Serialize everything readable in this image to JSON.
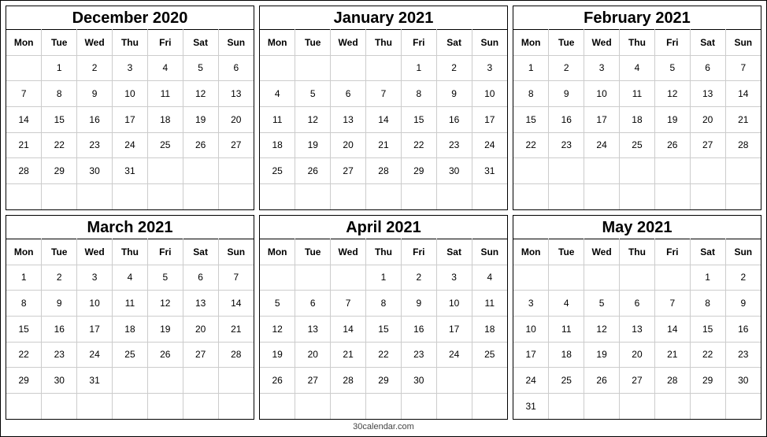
{
  "footer": "30calendar.com",
  "weekdays": [
    "Mon",
    "Tue",
    "Wed",
    "Thu",
    "Fri",
    "Sat",
    "Sun"
  ],
  "months": [
    {
      "title": "December 2020",
      "weeks": [
        [
          "",
          "1",
          "2",
          "3",
          "4",
          "5",
          "6"
        ],
        [
          "7",
          "8",
          "9",
          "10",
          "11",
          "12",
          "13"
        ],
        [
          "14",
          "15",
          "16",
          "17",
          "18",
          "19",
          "20"
        ],
        [
          "21",
          "22",
          "23",
          "24",
          "25",
          "26",
          "27"
        ],
        [
          "28",
          "29",
          "30",
          "31",
          "",
          "",
          ""
        ],
        [
          "",
          "",
          "",
          "",
          "",
          "",
          ""
        ]
      ]
    },
    {
      "title": "January 2021",
      "weeks": [
        [
          "",
          "",
          "",
          "",
          "1",
          "2",
          "3"
        ],
        [
          "4",
          "5",
          "6",
          "7",
          "8",
          "9",
          "10"
        ],
        [
          "11",
          "12",
          "13",
          "14",
          "15",
          "16",
          "17"
        ],
        [
          "18",
          "19",
          "20",
          "21",
          "22",
          "23",
          "24"
        ],
        [
          "25",
          "26",
          "27",
          "28",
          "29",
          "30",
          "31"
        ],
        [
          "",
          "",
          "",
          "",
          "",
          "",
          ""
        ]
      ]
    },
    {
      "title": "February 2021",
      "weeks": [
        [
          "1",
          "2",
          "3",
          "4",
          "5",
          "6",
          "7"
        ],
        [
          "8",
          "9",
          "10",
          "11",
          "12",
          "13",
          "14"
        ],
        [
          "15",
          "16",
          "17",
          "18",
          "19",
          "20",
          "21"
        ],
        [
          "22",
          "23",
          "24",
          "25",
          "26",
          "27",
          "28"
        ],
        [
          "",
          "",
          "",
          "",
          "",
          "",
          ""
        ],
        [
          "",
          "",
          "",
          "",
          "",
          "",
          ""
        ]
      ]
    },
    {
      "title": "March 2021",
      "weeks": [
        [
          "1",
          "2",
          "3",
          "4",
          "5",
          "6",
          "7"
        ],
        [
          "8",
          "9",
          "10",
          "11",
          "12",
          "13",
          "14"
        ],
        [
          "15",
          "16",
          "17",
          "18",
          "19",
          "20",
          "21"
        ],
        [
          "22",
          "23",
          "24",
          "25",
          "26",
          "27",
          "28"
        ],
        [
          "29",
          "30",
          "31",
          "",
          "",
          "",
          ""
        ],
        [
          "",
          "",
          "",
          "",
          "",
          "",
          ""
        ]
      ]
    },
    {
      "title": "April 2021",
      "weeks": [
        [
          "",
          "",
          "",
          "1",
          "2",
          "3",
          "4"
        ],
        [
          "5",
          "6",
          "7",
          "8",
          "9",
          "10",
          "11"
        ],
        [
          "12",
          "13",
          "14",
          "15",
          "16",
          "17",
          "18"
        ],
        [
          "19",
          "20",
          "21",
          "22",
          "23",
          "24",
          "25"
        ],
        [
          "26",
          "27",
          "28",
          "29",
          "30",
          "",
          ""
        ],
        [
          "",
          "",
          "",
          "",
          "",
          "",
          ""
        ]
      ]
    },
    {
      "title": "May 2021",
      "weeks": [
        [
          "",
          "",
          "",
          "",
          "",
          "1",
          "2"
        ],
        [
          "3",
          "4",
          "5",
          "6",
          "7",
          "8",
          "9"
        ],
        [
          "10",
          "11",
          "12",
          "13",
          "14",
          "15",
          "16"
        ],
        [
          "17",
          "18",
          "19",
          "20",
          "21",
          "22",
          "23"
        ],
        [
          "24",
          "25",
          "26",
          "27",
          "28",
          "29",
          "30"
        ],
        [
          "31",
          "",
          "",
          "",
          "",
          "",
          ""
        ]
      ]
    }
  ]
}
